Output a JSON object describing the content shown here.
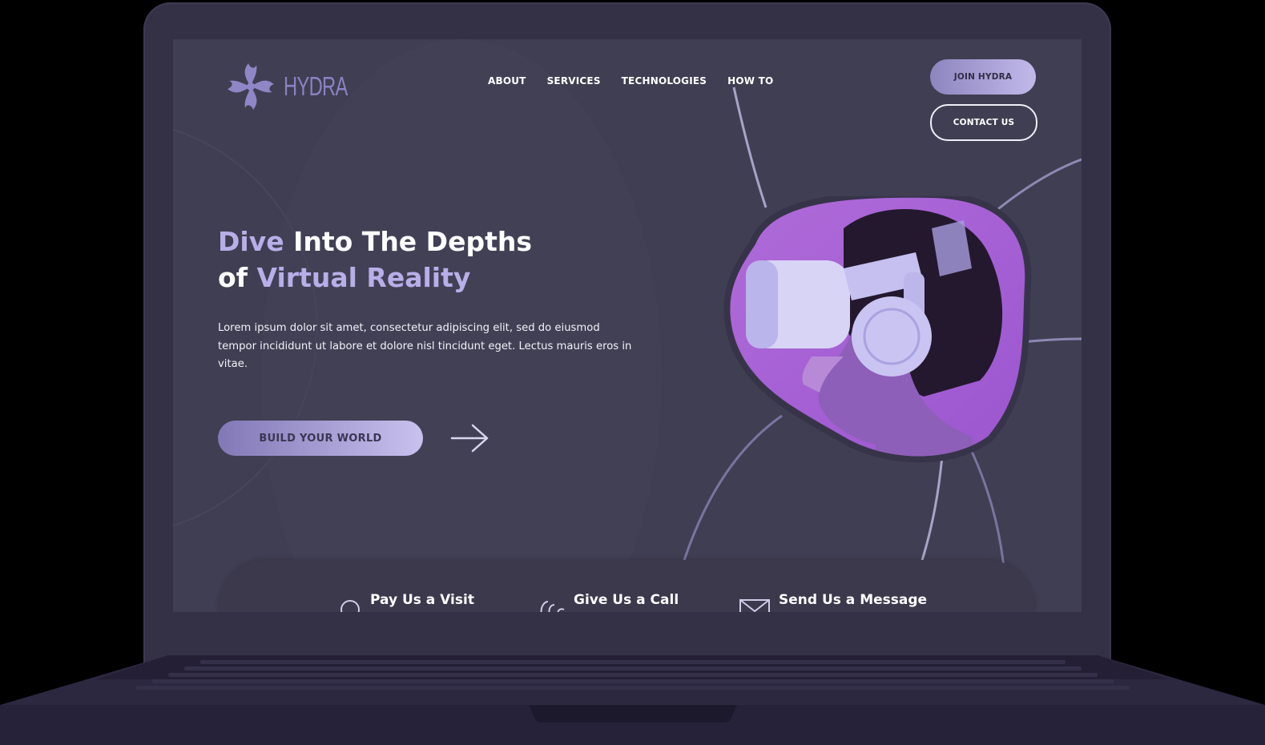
{
  "brand": {
    "name": "HYDRA"
  },
  "nav": [
    {
      "label": "ABOUT"
    },
    {
      "label": "SERVICES"
    },
    {
      "label": "TECHNOLOGIES"
    },
    {
      "label": "HOW TO"
    }
  ],
  "actions": {
    "join": "JOIN HYDRA",
    "contact": "CONTACT US"
  },
  "hero": {
    "title_line1_accent": "Dive",
    "title_line1_rest": " Into The Depths",
    "title_line2_start": "of ",
    "title_line2_accent": "Virtual Reality",
    "description": "Lorem ipsum dolor sit amet, consectetur adipiscing elit, sed do eiusmod tempor incididunt ut labore et dolore nisl tincidunt eget. Lectus mauris eros in vitae.",
    "cta": "BUILD YOUR WORLD"
  },
  "info": [
    {
      "label": "Pay Us a Visit",
      "icon": "location-icon"
    },
    {
      "label": "Give Us a Call",
      "icon": "phone-icon"
    },
    {
      "label": "Send Us a Message",
      "icon": "mail-icon"
    }
  ],
  "colors": {
    "background": "#403e52",
    "accent": "#b8aee8",
    "button_gradient_start": "#8178b6",
    "button_gradient_end": "#c9c1ee",
    "image_backdrop": "#a35fd6"
  }
}
